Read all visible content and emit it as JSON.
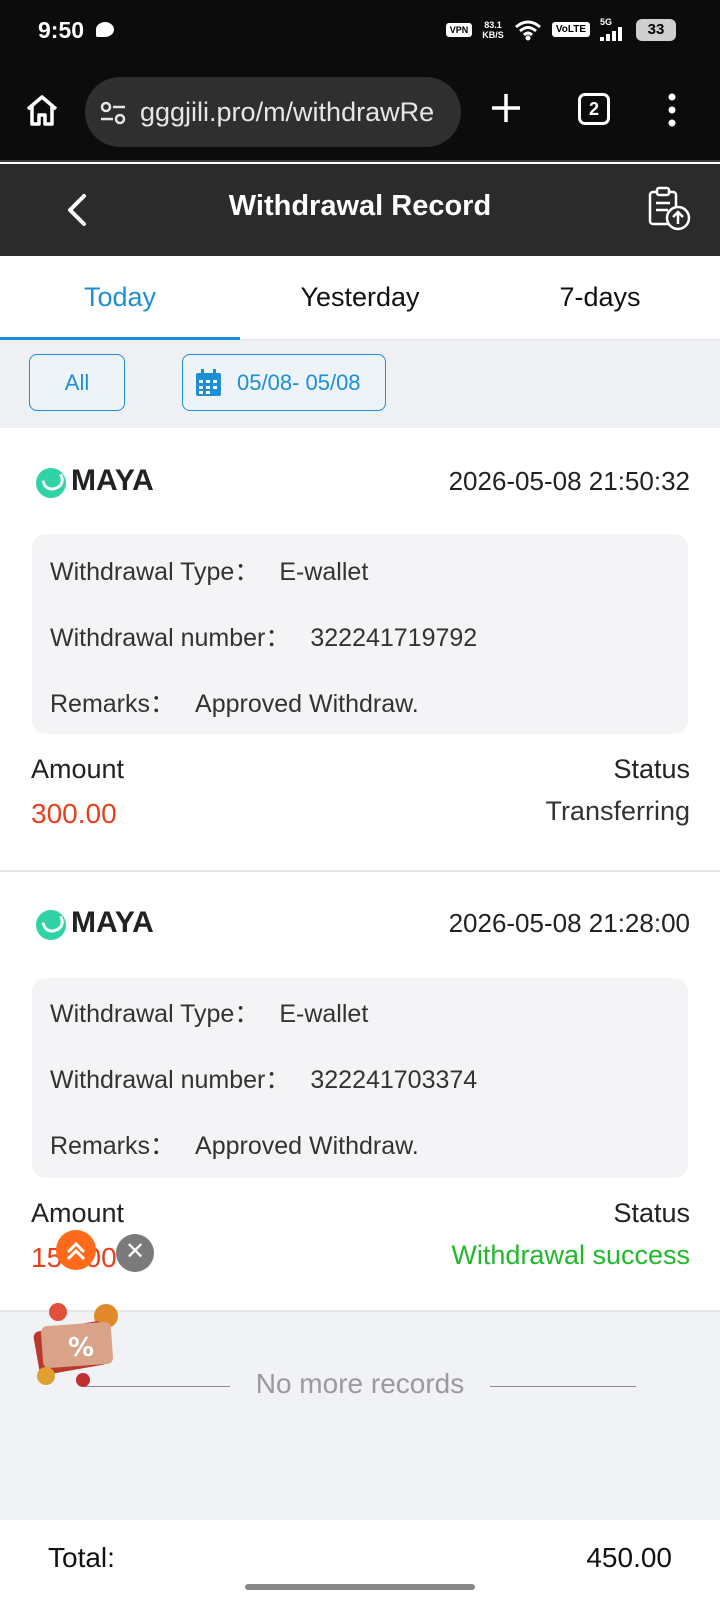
{
  "status_bar": {
    "time": "9:50",
    "vpn": "VPN",
    "speed_value": "83.1",
    "speed_unit": "KB/S",
    "volte": "VoLTE",
    "network": "5G",
    "battery": "33"
  },
  "browser": {
    "url": "gggjili.pro/m/withdrawRe",
    "tab_count": "2"
  },
  "header": {
    "title": "Withdrawal Record"
  },
  "tabs": [
    {
      "label": "Today",
      "active": true
    },
    {
      "label": "Yesterday",
      "active": false
    },
    {
      "label": "7-days",
      "active": false
    }
  ],
  "filters": {
    "all_label": "All",
    "date_range": "05/08- 05/08"
  },
  "records": [
    {
      "method": "MAYA",
      "datetime": "2026-05-08 21:50:32",
      "type_label": "Withdrawal Type：",
      "type_value": "E-wallet",
      "number_label": "Withdrawal number：",
      "number_value": "322241719792",
      "remarks_label": "Remarks：",
      "remarks_value": "Approved Withdraw.",
      "amount_label": "Amount",
      "amount_value": "300.00",
      "status_label": "Status",
      "status_value": "Transferring"
    },
    {
      "method": "MAYA",
      "datetime": "2026-05-08 21:28:00",
      "type_label": "Withdrawal Type：",
      "type_value": "E-wallet",
      "number_label": "Withdrawal number：",
      "number_value": "322241703374",
      "remarks_label": "Remarks：",
      "remarks_value": "Approved Withdraw.",
      "amount_label": "Amount",
      "amount_value": "150.00",
      "status_label": "Status",
      "status_value": "Withdrawal success"
    }
  ],
  "no_more": "No more records",
  "footer": {
    "total_label": "Total:",
    "total_value": "450.00"
  },
  "colors": {
    "accent": "#1c8fd6",
    "amount": "#e8401c",
    "success": "#1fb92b"
  }
}
